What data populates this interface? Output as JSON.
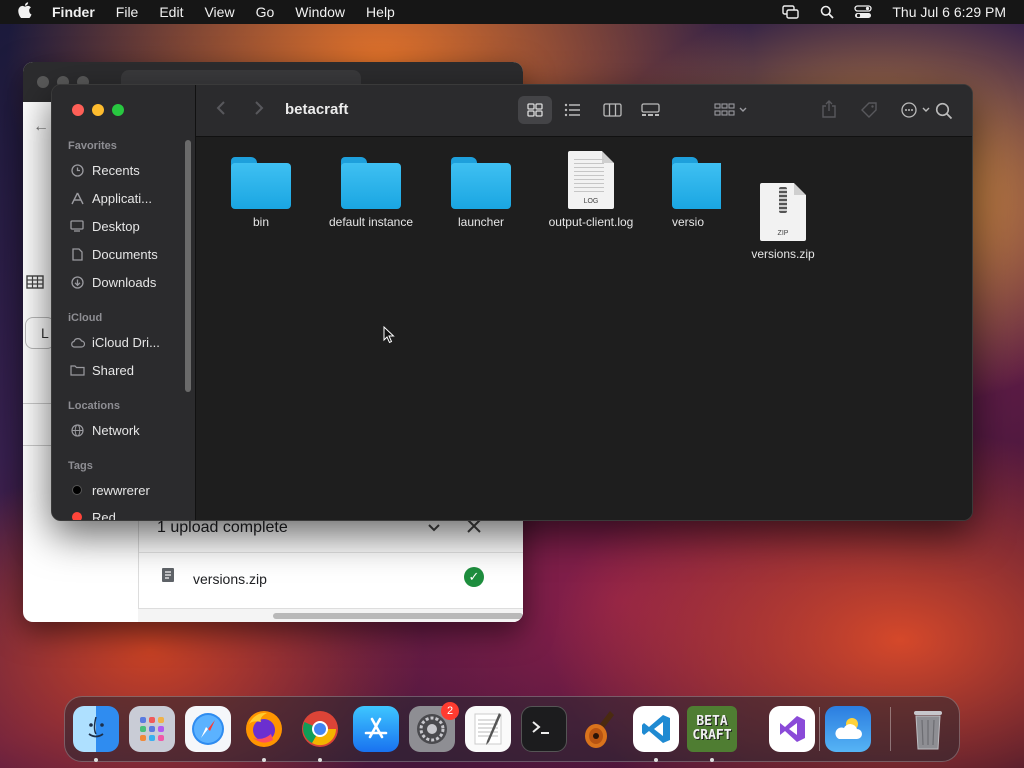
{
  "menubar": {
    "app_name": "Finder",
    "items": [
      "File",
      "Edit",
      "View",
      "Go",
      "Window",
      "Help"
    ],
    "clock": "Thu Jul 6  6:29 PM",
    "icons": [
      "apple-icon",
      "screen-mirroring-icon",
      "spotlight-search-icon",
      "control-center-icon"
    ]
  },
  "browser": {
    "grid_label": "▦",
    "letter_button": "L",
    "uploads": {
      "title": "1 upload complete",
      "items": [
        {
          "name": "versions.zip",
          "status": "complete"
        }
      ]
    }
  },
  "finder": {
    "title": "betacraft",
    "sidebar": {
      "favorites_header": "Favorites",
      "favorites": [
        "Recents",
        "Applicati...",
        "Desktop",
        "Documents",
        "Downloads"
      ],
      "icloud_header": "iCloud",
      "icloud": [
        "iCloud Dri...",
        "Shared"
      ],
      "locations_header": "Locations",
      "locations": [
        "Network"
      ],
      "tags_header": "Tags",
      "tags": [
        "rewwrerer",
        "Red"
      ]
    },
    "files": [
      {
        "name": "bin",
        "kind": "folder"
      },
      {
        "name": "default instance",
        "kind": "folder"
      },
      {
        "name": "launcher",
        "kind": "folder"
      },
      {
        "name": "output-client.log",
        "kind": "log",
        "badge": "LOG"
      },
      {
        "name": "versio",
        "kind": "folder"
      },
      {
        "name": "versions.zip",
        "kind": "zip",
        "badge": "ZIP"
      }
    ]
  },
  "dock": {
    "apps": [
      "Finder",
      "Launchpad",
      "Safari",
      "Firefox",
      "Chrome",
      "App Store",
      "System Settings",
      "TextEdit",
      "Terminal",
      "GarageBand",
      "Visual Studio Code",
      "BetaCraft",
      "Visual Studio",
      "Weather",
      "Trash"
    ],
    "settings_badge": "2",
    "betacraft_text": "BETA CRAFT"
  },
  "colors": {
    "finder_bg": "#1e1e1e",
    "sidebar_bg": "#2b2b2d",
    "folder_blue": "#2fb5ee",
    "accent_green": "#1e8e3e",
    "badge_red": "#ff3b30"
  }
}
